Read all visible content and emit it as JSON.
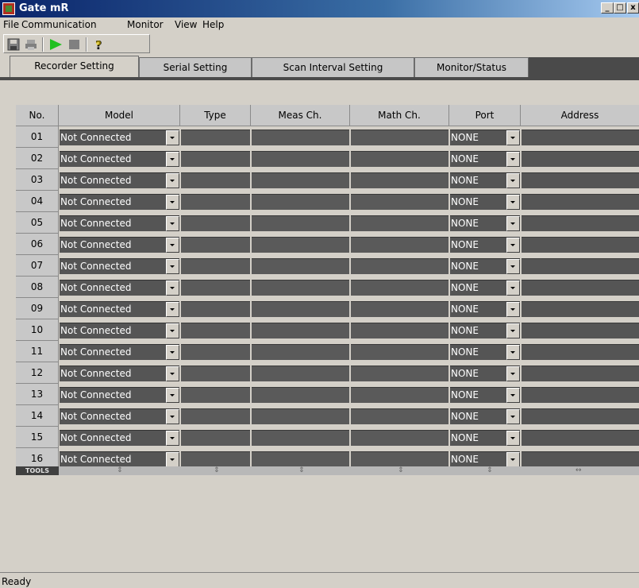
{
  "window": {
    "title": "Gate mR",
    "minimize": "_",
    "maximize": "□",
    "close": "x"
  },
  "menu": [
    "File",
    "Communication",
    "Monitor",
    "View",
    "Help"
  ],
  "toolbar": {
    "buttons": [
      "save-icon",
      "print-icon",
      "play-icon",
      "stop-icon",
      "help-icon"
    ],
    "play_color": "#20c020"
  },
  "tabs": [
    {
      "label": "Recorder Setting",
      "active": true
    },
    {
      "label": "Serial Setting",
      "active": false
    },
    {
      "label": "Scan Interval Setting",
      "active": false
    },
    {
      "label": "Monitor/Status",
      "active": false
    }
  ],
  "grid": {
    "columns": [
      "No.",
      "Model",
      "Type",
      "Meas Ch.",
      "Math Ch.",
      "Port",
      "Address"
    ],
    "rows": [
      {
        "no": "01",
        "model": "Not Connected",
        "port": "NONE"
      },
      {
        "no": "02",
        "model": "Not Connected",
        "port": "NONE"
      },
      {
        "no": "03",
        "model": "Not Connected",
        "port": "NONE"
      },
      {
        "no": "04",
        "model": "Not Connected",
        "port": "NONE"
      },
      {
        "no": "05",
        "model": "Not Connected",
        "port": "NONE"
      },
      {
        "no": "06",
        "model": "Not Connected",
        "port": "NONE"
      },
      {
        "no": "07",
        "model": "Not Connected",
        "port": "NONE"
      },
      {
        "no": "08",
        "model": "Not Connected",
        "port": "NONE"
      },
      {
        "no": "09",
        "model": "Not Connected",
        "port": "NONE"
      },
      {
        "no": "10",
        "model": "Not Connected",
        "port": "NONE"
      },
      {
        "no": "11",
        "model": "Not Connected",
        "port": "NONE"
      },
      {
        "no": "12",
        "model": "Not Connected",
        "port": "NONE"
      },
      {
        "no": "13",
        "model": "Not Connected",
        "port": "NONE"
      },
      {
        "no": "14",
        "model": "Not Connected",
        "port": "NONE"
      },
      {
        "no": "15",
        "model": "Not Connected",
        "port": "NONE"
      },
      {
        "no": "16",
        "model": "Not Connected",
        "port": "NONE"
      }
    ],
    "tools_label": "TOOLS"
  },
  "status": {
    "text": "Ready"
  }
}
